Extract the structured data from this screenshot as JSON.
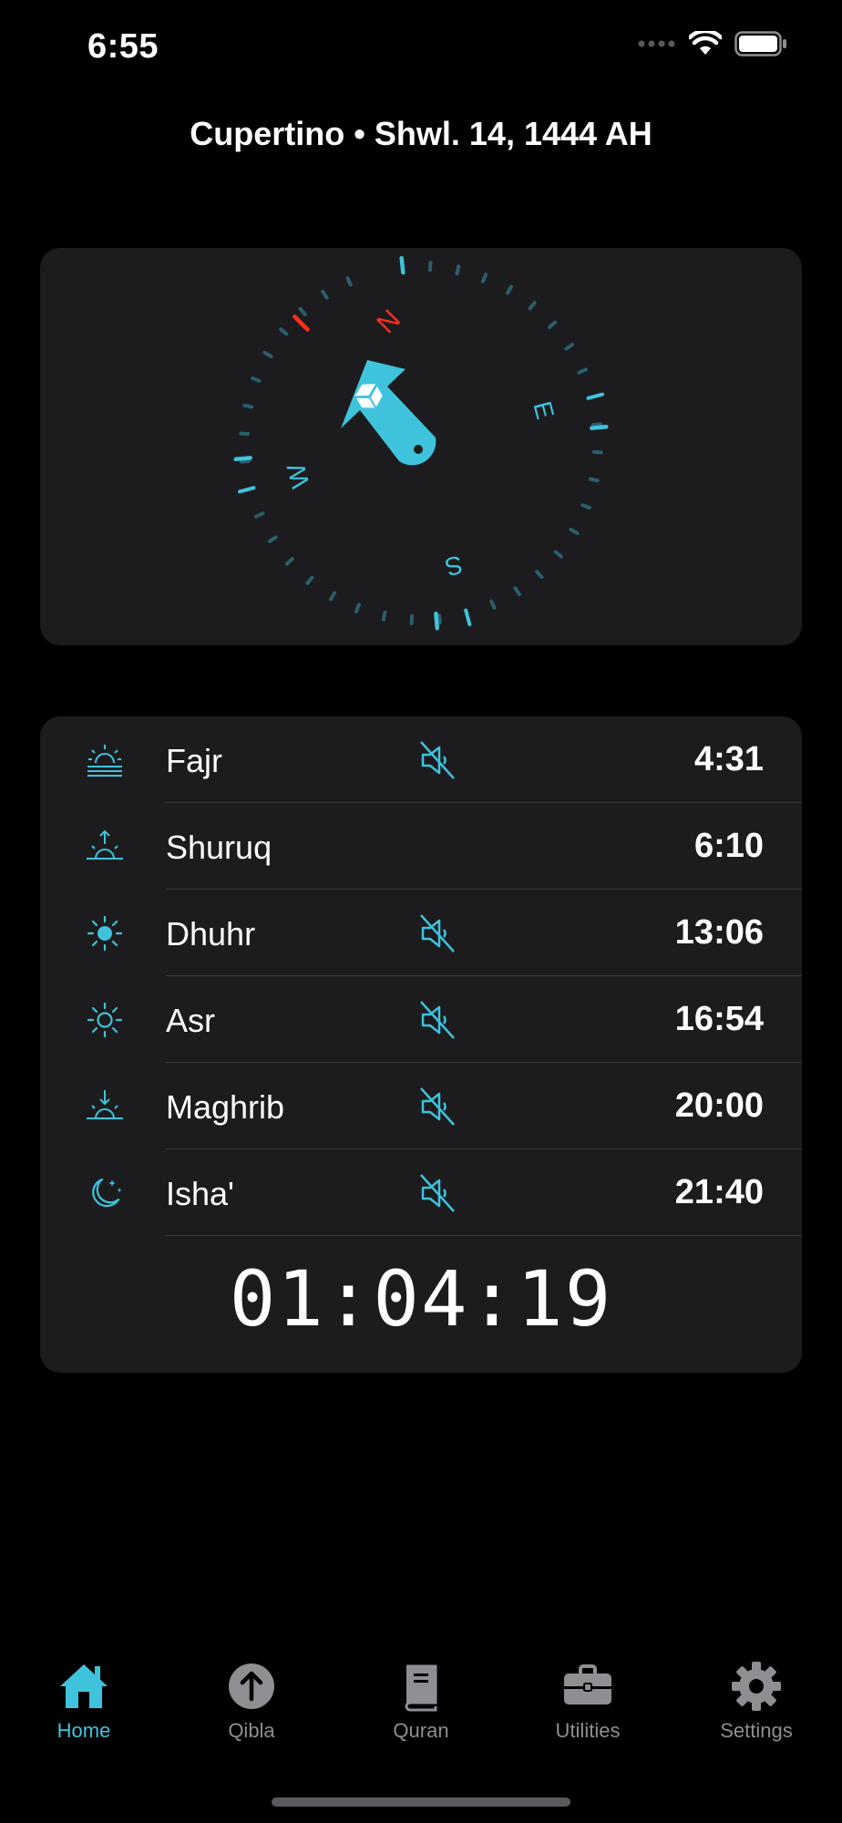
{
  "status_bar": {
    "time": "6:55"
  },
  "header": {
    "title": "Cupertino • Shwl. 14, 1444 AH"
  },
  "colors": {
    "accent": "#3fc3dd",
    "card": "#1c1c1e",
    "north": "#ff2d1a",
    "muted": "#8e8e93"
  },
  "compass": {
    "labels": {
      "north": "N",
      "east": "E",
      "south": "S",
      "west": "W"
    },
    "icon": "kaaba-icon"
  },
  "prayers": [
    {
      "name": "Fajr",
      "time": "4:31",
      "icon": "sunrise-lines-icon",
      "muted": true
    },
    {
      "name": "Shuruq",
      "time": "6:10",
      "icon": "sunrise-arrow-icon",
      "muted": false
    },
    {
      "name": "Dhuhr",
      "time": "13:06",
      "icon": "sun-filled-icon",
      "muted": true
    },
    {
      "name": "Asr",
      "time": "16:54",
      "icon": "sun-outline-icon",
      "muted": true
    },
    {
      "name": "Maghrib",
      "time": "20:00",
      "icon": "sunset-arrow-icon",
      "muted": true
    },
    {
      "name": "Isha'",
      "time": "21:40",
      "icon": "moon-stars-icon",
      "muted": true
    }
  ],
  "countdown": "01:04:19",
  "tabs": [
    {
      "label": "Home",
      "icon": "house-icon",
      "active": true
    },
    {
      "label": "Qibla",
      "icon": "arrow-up-circle-icon",
      "active": false
    },
    {
      "label": "Quran",
      "icon": "book-icon",
      "active": false
    },
    {
      "label": "Utilities",
      "icon": "briefcase-icon",
      "active": false
    },
    {
      "label": "Settings",
      "icon": "gear-icon",
      "active": false
    }
  ]
}
